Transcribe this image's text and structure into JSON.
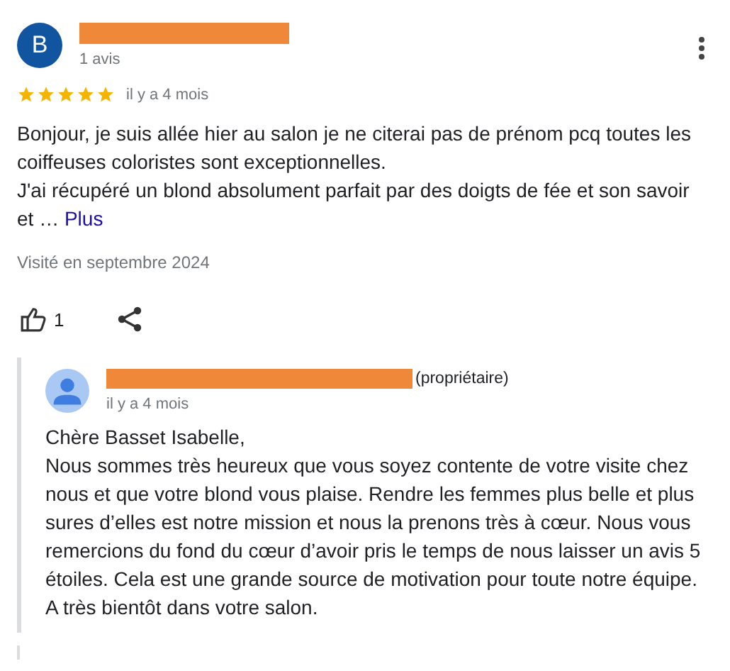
{
  "review": {
    "avatar_letter": "B",
    "review_count": "1 avis",
    "stars": 5,
    "time": "il y a 4 mois",
    "text_lines": [
      "Bonjour, je suis allée hier au salon je ne citerai pas de prénom pcq toutes les",
      "coiffeuses coloristes sont exceptionnelles.",
      "J'ai récupéré un blond absolument parfait par des doigts de fée et son savoir",
      "et … "
    ],
    "more_link": "Plus",
    "visited": "Visité en septembre 2024",
    "likes": "1"
  },
  "owner_reply": {
    "role": "(propriétaire)",
    "time": "il y a 4 mois",
    "text_lines": [
      "Chère Basset Isabelle,",
      "Nous sommes très heureux que vous soyez contente de votre visite chez",
      "nous et que votre blond vous plaise. Rendre les femmes plus belle et plus",
      "sures d’elles est notre mission et nous la prenons très à cœur. Nous vous",
      "remercions du fond du cœur d’avoir pris le temps de nous laisser un avis 5",
      "étoiles. Cela est une grande source de motivation pour toute notre équipe.",
      "A très bientôt dans votre salon."
    ]
  }
}
